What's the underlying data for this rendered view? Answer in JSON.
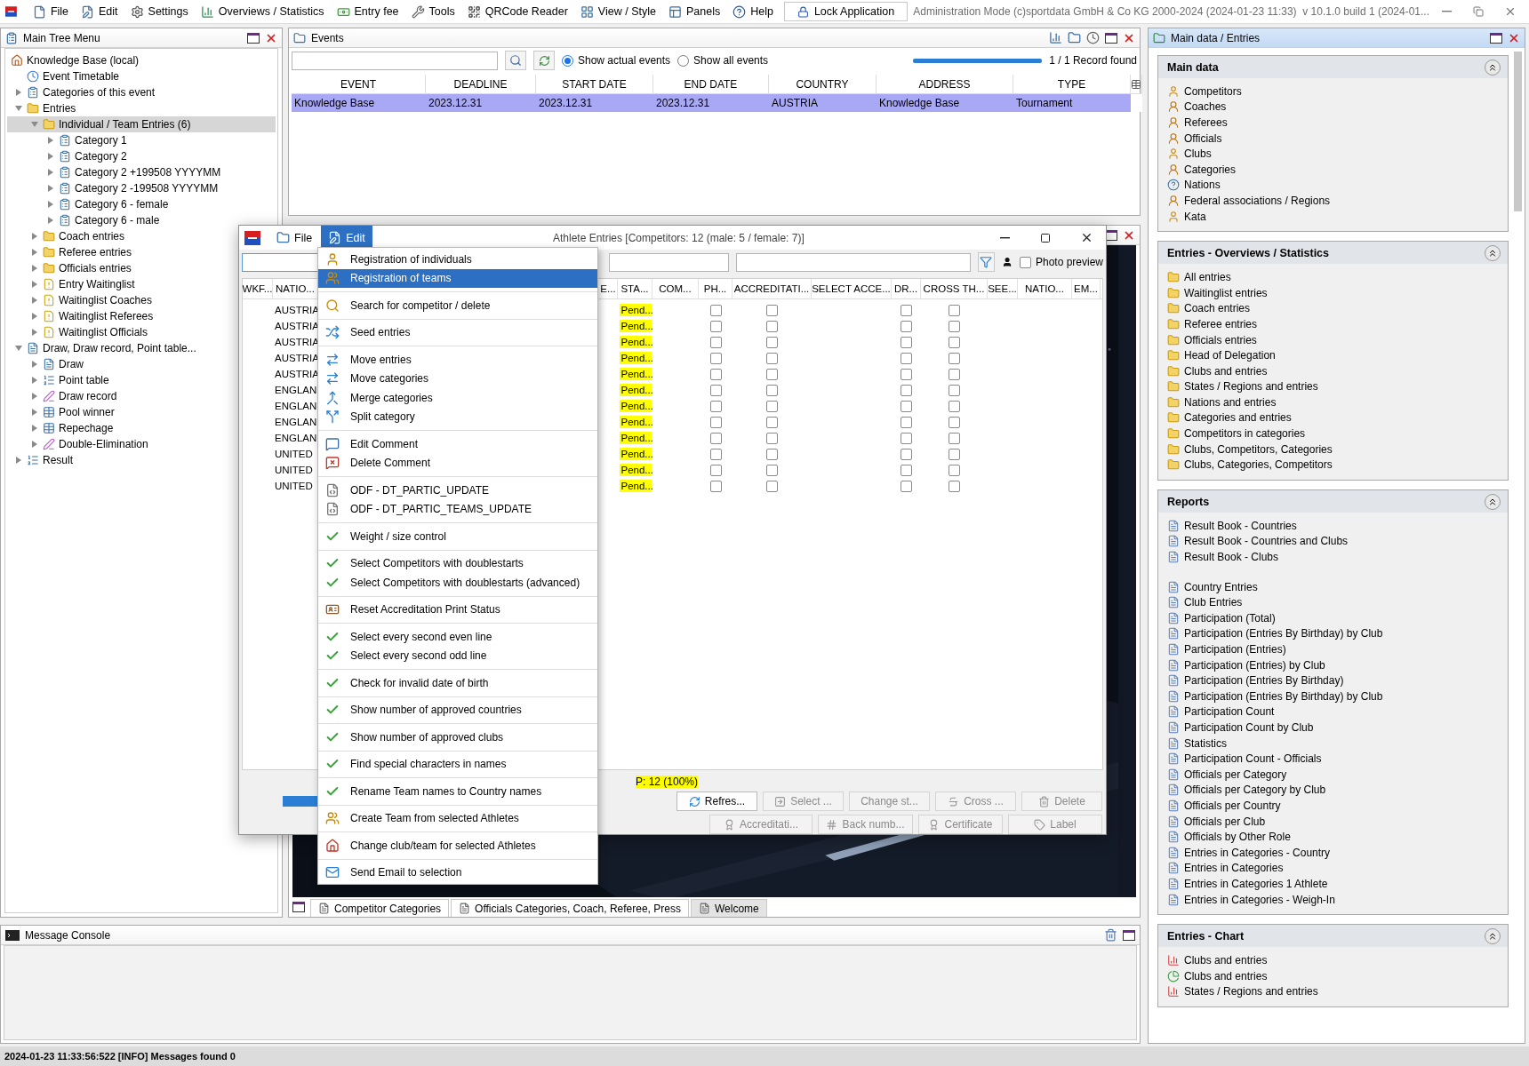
{
  "menubar": {
    "items": [
      {
        "label": "File"
      },
      {
        "label": "Edit"
      },
      {
        "label": "Settings"
      },
      {
        "label": "Overviews / Statistics"
      },
      {
        "label": "Entry fee"
      },
      {
        "label": "Tools"
      },
      {
        "label": "QRCode Reader"
      },
      {
        "label": "View / Style"
      },
      {
        "label": "Panels"
      },
      {
        "label": "Help"
      }
    ],
    "lock_button": "Lock Application",
    "title": "Administration Mode (c)sportdata GmbH & Co KG 2000-2024 (2024-01-23 11:33)  v 10.1.0 build 1 (2024-01..."
  },
  "tree_panel": {
    "title": "Main Tree Menu",
    "root": "Knowledge Base (local)",
    "items": [
      {
        "label": "Event Timetable",
        "kind": "clock",
        "selected": false
      },
      {
        "label": "Categories of this event",
        "kind": "category",
        "expanded": false,
        "selected": false
      },
      {
        "label": "Entries",
        "kind": "folder",
        "expanded": true,
        "selected": false,
        "children": [
          {
            "label": "Individual / Team Entries (6)",
            "kind": "folder",
            "expanded": true,
            "selected": true,
            "children": [
              {
                "label": "Category 1",
                "kind": "category",
                "expanded": false,
                "selected": false
              },
              {
                "label": "Category 2",
                "kind": "category",
                "expanded": false,
                "selected": false
              },
              {
                "label": "Category 2 +199508 YYYYMM",
                "kind": "category",
                "expanded": false,
                "selected": false
              },
              {
                "label": "Category 2 -199508 YYYYMM",
                "kind": "category",
                "expanded": false,
                "selected": false
              },
              {
                "label": "Category 6 - female",
                "kind": "category",
                "expanded": false,
                "selected": false
              },
              {
                "label": "Category 6 - male",
                "kind": "category",
                "expanded": false,
                "selected": false
              }
            ]
          },
          {
            "label": "Coach entries",
            "kind": "folder",
            "expanded": false,
            "selected": false
          },
          {
            "label": "Referee entries",
            "kind": "folder",
            "expanded": false,
            "selected": false
          },
          {
            "label": "Officials entries",
            "kind": "folder",
            "expanded": false,
            "selected": false
          },
          {
            "label": "Entry Waitinglist",
            "kind": "warning",
            "expanded": false,
            "selected": false
          },
          {
            "label": "Waitinglist Coaches",
            "kind": "warning",
            "expanded": false,
            "selected": false
          },
          {
            "label": "Waitinglist Referees",
            "kind": "warning",
            "expanded": false,
            "selected": false
          },
          {
            "label": "Waitinglist Officials",
            "kind": "warning",
            "expanded": false,
            "selected": false
          }
        ]
      },
      {
        "label": "Draw, Draw record, Point table...",
        "kind": "draw",
        "expanded": true,
        "selected": false,
        "children": [
          {
            "label": "Draw",
            "kind": "draw",
            "expanded": false,
            "selected": false
          },
          {
            "label": "Point table",
            "kind": "list",
            "expanded": false,
            "selected": false
          },
          {
            "label": "Draw record",
            "kind": "record",
            "expanded": false,
            "selected": false
          },
          {
            "label": "Pool winner",
            "kind": "table",
            "expanded": false,
            "selected": false
          },
          {
            "label": "Repechage",
            "kind": "table",
            "expanded": false,
            "selected": false
          },
          {
            "label": "Double-Elimination",
            "kind": "record",
            "expanded": false,
            "selected": false
          }
        ]
      },
      {
        "label": "Result",
        "kind": "list",
        "expanded": false,
        "selected": false
      }
    ]
  },
  "events_panel": {
    "title": "Events",
    "radios": [
      {
        "label": "Show actual events",
        "selected": true
      },
      {
        "label": "Show all events",
        "selected": false
      }
    ],
    "progress": {
      "level": 1
    },
    "record_count": "1 / 1 Record found",
    "table": {
      "columns": [
        "EVENT",
        "DEADLINE",
        "START DATE",
        "END DATE",
        "COUNTRY",
        "ADDRESS",
        "TYPE"
      ],
      "rows": [
        {
          "cells": [
            "Knowledge Base",
            "2023.12.31",
            "2023.12.31",
            "2023.12.31",
            "AUSTRIA",
            "Knowledge Base",
            "Tournament"
          ],
          "selected": true
        }
      ]
    }
  },
  "bottom_tabs": [
    {
      "label": "Competitor Categories",
      "selected": false
    },
    {
      "label": "Officials Categories, Coach, Referee, Press",
      "selected": false
    },
    {
      "label": "Welcome",
      "selected": true
    }
  ],
  "athlete_window": {
    "title": "Athlete Entries [Competitors: 12 (male: 5 / female: 7)]",
    "menus": [
      {
        "label": "File",
        "selected": false
      },
      {
        "label": "Edit",
        "selected": true
      }
    ],
    "photo_preview": {
      "label": "Photo preview",
      "checked": false
    },
    "columns": [
      "WKF...",
      "NATIO...",
      "E...",
      "STA...",
      "COM...",
      "PH...",
      "ACCREDITATI...",
      "SELECT ACCE...",
      "DR...",
      "CROSS TH...",
      "SEE...",
      "NATIO...",
      "EM..."
    ],
    "rows": [
      {
        "nation": "AUSTRIA",
        "status": "Pend...",
        "checks": [
          false,
          false,
          false,
          false
        ]
      },
      {
        "nation": "AUSTRIA",
        "status": "Pend...",
        "checks": [
          false,
          false,
          false,
          false
        ]
      },
      {
        "nation": "AUSTRIA",
        "status": "Pend...",
        "checks": [
          false,
          false,
          false,
          false
        ]
      },
      {
        "nation": "AUSTRIA",
        "status": "Pend...",
        "checks": [
          false,
          false,
          false,
          false
        ]
      },
      {
        "nation": "AUSTRIA",
        "status": "Pend...",
        "checks": [
          false,
          false,
          false,
          false
        ]
      },
      {
        "nation": "ENGLAN",
        "status": "Pend...",
        "checks": [
          false,
          false,
          false,
          false
        ]
      },
      {
        "nation": "ENGLAN",
        "status": "Pend...",
        "checks": [
          false,
          false,
          false,
          false
        ]
      },
      {
        "nation": "ENGLAN",
        "status": "Pend...",
        "checks": [
          false,
          false,
          false,
          false
        ]
      },
      {
        "nation": "ENGLAN",
        "status": "Pend...",
        "checks": [
          false,
          false,
          false,
          false
        ]
      },
      {
        "nation": "UNITED",
        "status": "Pend...",
        "checks": [
          false,
          false,
          false,
          false
        ]
      },
      {
        "nation": "UNITED",
        "status": "Pend...",
        "checks": [
          false,
          false,
          false,
          false
        ]
      },
      {
        "nation": "UNITED",
        "status": "Pend...",
        "checks": [
          false,
          false,
          false,
          false
        ]
      }
    ],
    "progress": {
      "level": 1
    },
    "summary": "P: 12 (100%)",
    "buttons": [
      [
        {
          "label": "Refres...",
          "disabled": false
        },
        {
          "label": "Select ...",
          "disabled": true
        },
        {
          "label": "Change st...",
          "disabled": true
        },
        {
          "label": "Cross ...",
          "disabled": true
        },
        {
          "label": "Delete",
          "disabled": true
        }
      ],
      [
        {
          "label": "Accreditati...",
          "disabled": true
        },
        {
          "label": "Back numb...",
          "disabled": true
        },
        {
          "label": "Certificate",
          "disabled": true
        },
        {
          "label": "Label",
          "disabled": true
        }
      ]
    ]
  },
  "edit_menu": {
    "groups": [
      [
        {
          "label": "Registration of individuals",
          "kind": "person",
          "selected": false
        },
        {
          "label": "Registration of teams",
          "kind": "team",
          "selected": true
        }
      ],
      [
        {
          "label": "Search for competitor / delete",
          "kind": "search",
          "selected": false
        }
      ],
      [
        {
          "label": "Seed entries",
          "kind": "seed",
          "selected": false
        }
      ],
      [
        {
          "label": "Move entries",
          "kind": "move",
          "selected": false
        },
        {
          "label": "Move categories",
          "kind": "move",
          "selected": false
        },
        {
          "label": "Merge categories",
          "kind": "merge",
          "selected": false
        },
        {
          "label": "Split category",
          "kind": "split",
          "selected": false
        }
      ],
      [
        {
          "label": "Edit Comment",
          "kind": "comment",
          "selected": false
        },
        {
          "label": "Delete Comment",
          "kind": "uncomment",
          "selected": false
        }
      ],
      [
        {
          "label": "ODF - DT_PARTIC_UPDATE",
          "kind": "file",
          "selected": false
        },
        {
          "label": "ODF - DT_PARTIC_TEAMS_UPDATE",
          "kind": "file",
          "selected": false
        }
      ],
      [
        {
          "label": "Weight / size control",
          "kind": "check",
          "selected": false
        }
      ],
      [
        {
          "label": "Select Competitors with doublestarts",
          "kind": "check",
          "selected": false
        },
        {
          "label": "Select Competitors with doublestarts (advanced)",
          "kind": "check",
          "selected": false
        }
      ],
      [
        {
          "label": "Reset Accreditation Print Status",
          "kind": "badge",
          "selected": false
        }
      ],
      [
        {
          "label": "Select every second even line",
          "kind": "check",
          "selected": false
        },
        {
          "label": "Select every second odd line",
          "kind": "check",
          "selected": false
        }
      ],
      [
        {
          "label": "Check for invalid date of birth",
          "kind": "check",
          "selected": false
        }
      ],
      [
        {
          "label": "Show number of approved countries",
          "kind": "check",
          "selected": false
        }
      ],
      [
        {
          "label": "Show number of approved clubs",
          "kind": "check",
          "selected": false
        }
      ],
      [
        {
          "label": "Find special characters in names",
          "kind": "check",
          "selected": false
        }
      ],
      [
        {
          "label": "Rename Team names to Country names",
          "kind": "check",
          "selected": false
        }
      ],
      [
        {
          "label": "Create Team from selected Athletes",
          "kind": "team",
          "selected": false
        }
      ],
      [
        {
          "label": "Change club/team for selected Athletes",
          "kind": "house",
          "selected": false
        }
      ],
      [
        {
          "label": "Send Email to selection",
          "kind": "mail",
          "selected": false
        }
      ]
    ]
  },
  "console": {
    "title": "Message Console"
  },
  "right_panel": {
    "title": "Main data / Entries",
    "sections": [
      {
        "title": "Main data",
        "kind": "data",
        "expanded": true,
        "groups": [
          [
            "Competitors",
            "Coaches",
            "Referees",
            "Officials",
            "Clubs",
            "Categories",
            "Nations",
            "Federal associations / Regions",
            "Kata"
          ]
        ]
      },
      {
        "title": "Entries - Overviews / Statistics",
        "kind": "list",
        "expanded": true,
        "groups": [
          [
            "All entries",
            "Waitinglist entries",
            "Coach entries",
            "Referee entries",
            "Officials entries",
            "Head of Delegation",
            "Clubs and entries",
            "States / Regions and entries",
            "Nations and entries",
            "Categories and entries",
            "Competitors in categories",
            "Clubs, Competitors, Categories",
            "Clubs, Categories, Competitors"
          ]
        ]
      },
      {
        "title": "Reports",
        "kind": "report",
        "expanded": true,
        "groups": [
          [
            "Result Book - Countries",
            "Result Book - Countries and Clubs",
            "Result Book - Clubs"
          ],
          [
            "Country Entries",
            "Club Entries",
            "Participation (Total)",
            "Participation (Entries By Birthday) by Club",
            "Participation (Entries)",
            "Participation (Entries) by Club",
            "Participation (Entries By Birthday)",
            "Participation (Entries By Birthday) by Club",
            "Participation Count",
            "Participation Count by Club",
            "Statistics",
            "Participation Count - Officials",
            "Officials per Category",
            "Officials per Category by Club",
            "Officials per Country",
            "Officials per Club",
            "Officials by Other Role",
            "Entries in Categories - Country",
            "Entries in Categories",
            "Entries in Categories 1 Athlete",
            "Entries in Categories - Weigh-In"
          ]
        ]
      },
      {
        "title": "Entries - Chart",
        "kind": "chart",
        "expanded": true,
        "groups": [
          [
            "Clubs and entries",
            "Clubs and entries",
            "States / Regions and entries"
          ]
        ]
      }
    ]
  },
  "status_bar": "2024-01-23 11:33:56:522 [INFO] Messages found 0"
}
